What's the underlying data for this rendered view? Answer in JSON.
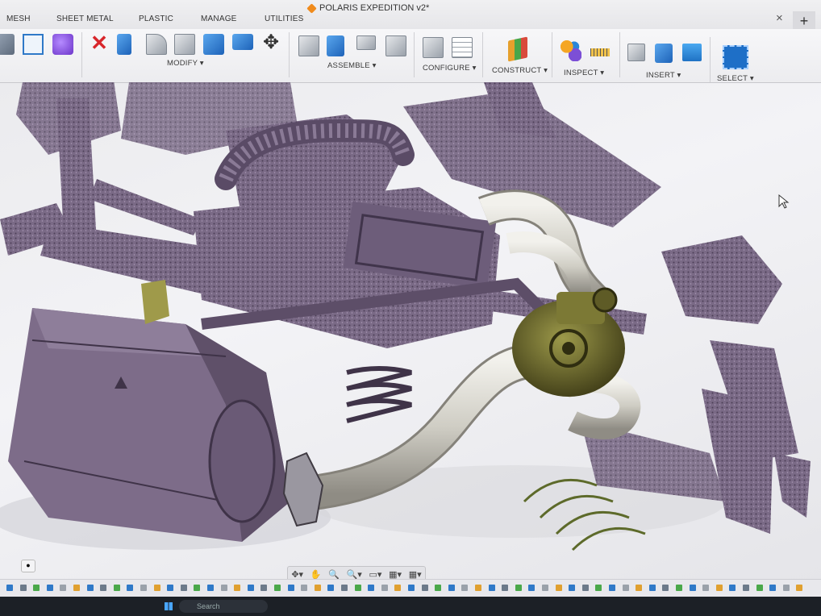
{
  "app": {
    "document_title": "POLARIS EXPEDITION v2*"
  },
  "tabs": [
    "MESH",
    "SHEET METAL",
    "PLASTIC",
    "MANAGE",
    "UTILITIES"
  ],
  "tab_close": "×",
  "tab_new": "+",
  "ribbon_groups": {
    "modify": "MODIFY ▾",
    "assemble": "ASSEMBLE ▾",
    "configure": "CONFIGURE ▾",
    "construct": "CONSTRUCT ▾",
    "inspect": "INSPECT ▾",
    "insert": "INSERT ▾",
    "select": "SELECT ▾"
  },
  "nav_bar": [
    "✥▾",
    "✋",
    "🔍",
    "🔍▾",
    "▭▾",
    "▦▾",
    "▦▾"
  ],
  "colors": {
    "mesh": "#7a6a86",
    "mesh_dark": "#4d4058",
    "pipe": "#d4d2c9",
    "turbo": "#6e6a2e",
    "accent": "#1e6fc7"
  },
  "taskbar": {
    "search_placeholder": "Search"
  }
}
